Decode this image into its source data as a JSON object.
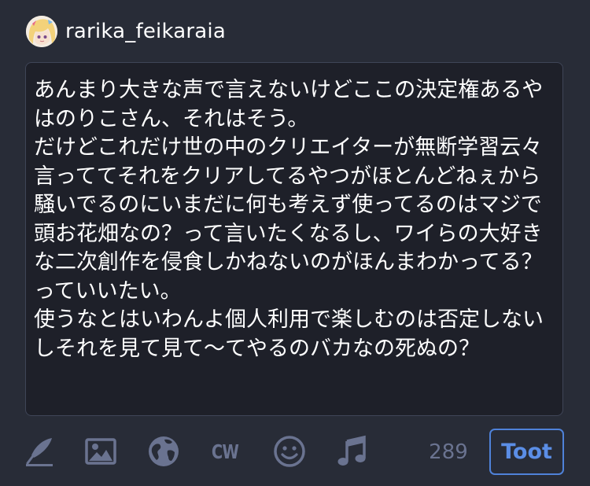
{
  "account": {
    "username": "rarika_feikaraia"
  },
  "compose": {
    "text": "あんまり大きな声で言えないけどここの決定権あるやはのりこさん、それはそう。\nだけどこれだけ世の中のクリエイターが無断学習云々言っててそれをクリアしてるやつがほとんどねぇから騒いでるのにいまだに何も考えず使ってるのはマジで頭お花畑なの？って言いたくなるし、ワイらの大好きな二次創作を侵食しかねないのがほんまわかってる？っていいたい。\n使うなとはいわんよ個人利用で楽しむのは否定しないしそれを見て見て〜てやるのバカなの死ぬの？"
  },
  "toolbar": {
    "icons": [
      "quill-icon",
      "image-icon",
      "globe-icon",
      "cw-icon",
      "emoji-icon",
      "music-note-icon"
    ],
    "cw_label": "CW",
    "char_count": "289",
    "toot_label": "Toot"
  },
  "colors": {
    "background": "#282c37",
    "compose_background": "#1e2029",
    "icon_gray": "#6a7390",
    "accent": "#4f82d9"
  }
}
